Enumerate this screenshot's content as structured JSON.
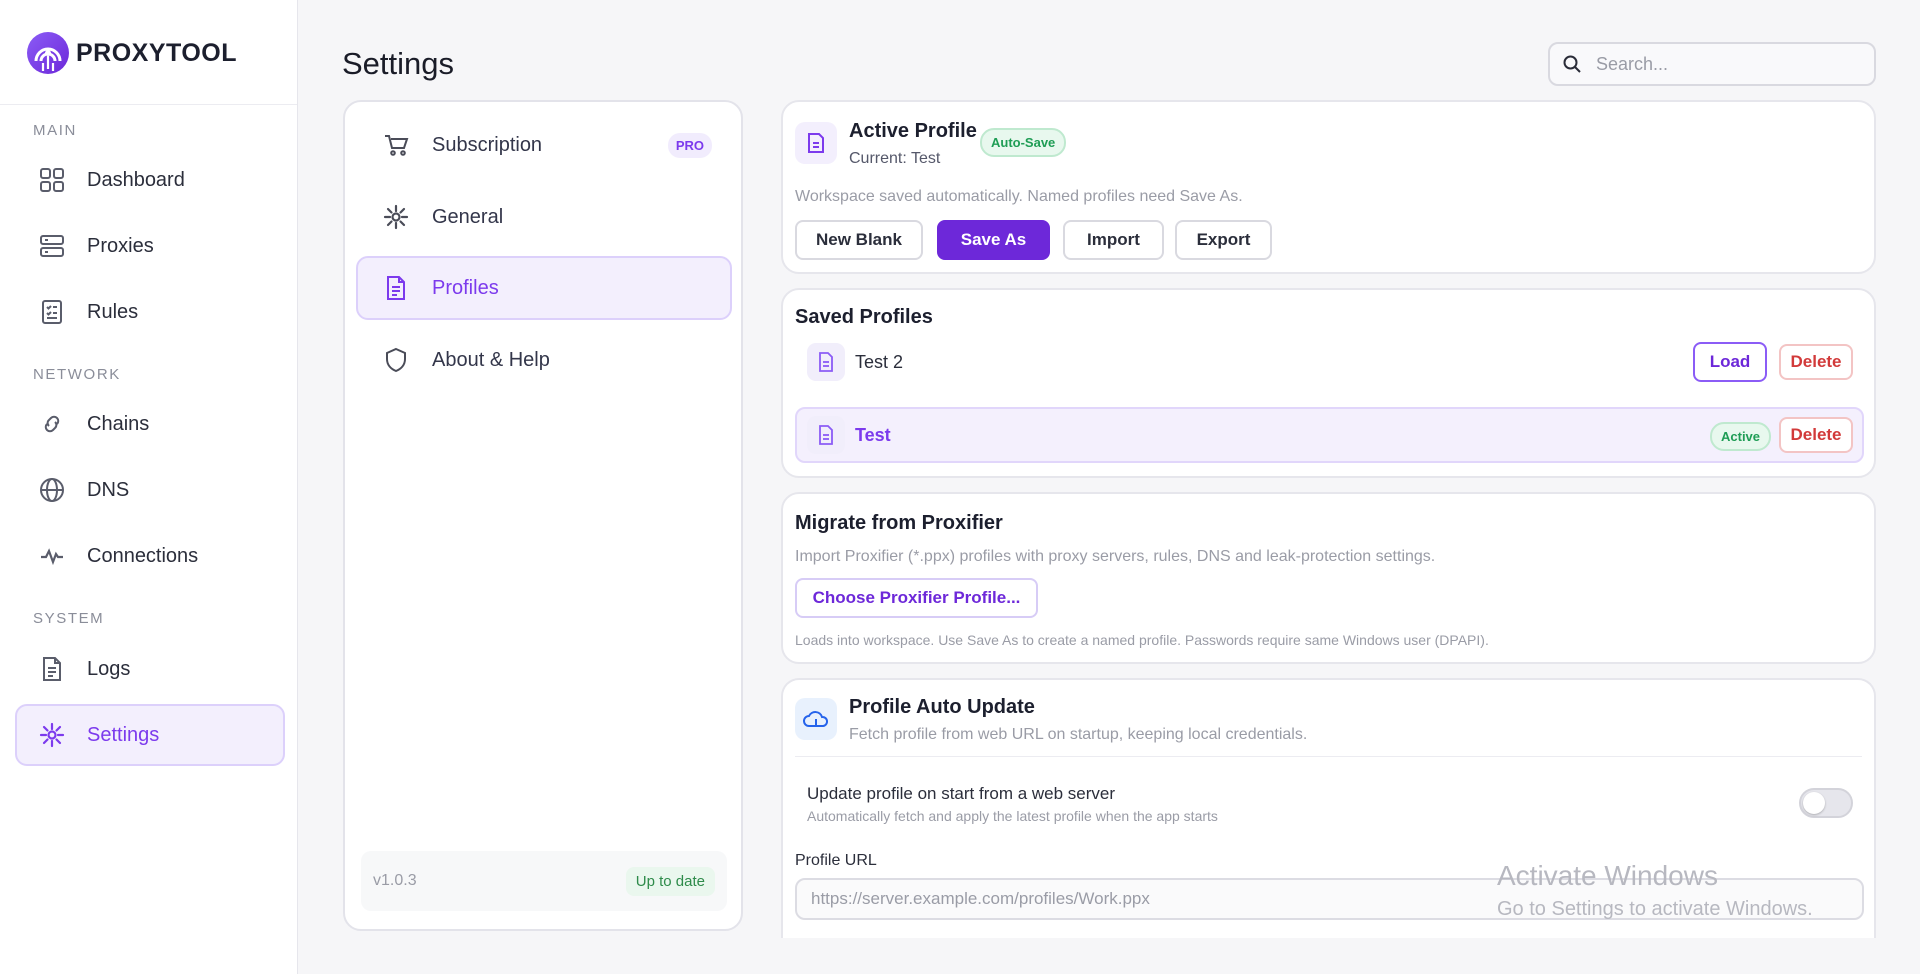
{
  "app": {
    "name": "PROXYTOOL",
    "logo_icon": "proxytool-logo"
  },
  "sidebar": {
    "sections": [
      {
        "label": "MAIN",
        "items": [
          {
            "label": "Dashboard",
            "icon": "grid-icon"
          },
          {
            "label": "Proxies",
            "icon": "server-icon"
          },
          {
            "label": "Rules",
            "icon": "checklist-icon"
          }
        ]
      },
      {
        "label": "NETWORK",
        "items": [
          {
            "label": "Chains",
            "icon": "link-icon"
          },
          {
            "label": "DNS",
            "icon": "globe-icon"
          },
          {
            "label": "Connections",
            "icon": "activity-icon"
          }
        ]
      },
      {
        "label": "SYSTEM",
        "items": [
          {
            "label": "Logs",
            "icon": "file-text-icon"
          },
          {
            "label": "Settings",
            "icon": "settings-icon",
            "active": true
          }
        ]
      }
    ]
  },
  "header": {
    "title": "Settings",
    "search_placeholder": "Search..."
  },
  "settings_nav": {
    "items": [
      {
        "label": "Subscription",
        "icon": "cart-icon",
        "badge": "PRO"
      },
      {
        "label": "General",
        "icon": "gear-icon"
      },
      {
        "label": "Profiles",
        "icon": "document-icon",
        "active": true
      },
      {
        "label": "About & Help",
        "icon": "shield-icon"
      }
    ],
    "version": "v1.0.3",
    "status": "Up to date"
  },
  "active_profile": {
    "title": "Active Profile",
    "current": "Current: Test",
    "badge": "Auto-Save",
    "description": "Workspace saved automatically. Named profiles need Save As.",
    "buttons": {
      "new_blank": "New Blank",
      "save_as": "Save As",
      "import": "Import",
      "export": "Export"
    }
  },
  "saved_profiles": {
    "title": "Saved Profiles",
    "rows": [
      {
        "name": "Test 2",
        "load": "Load",
        "delete": "Delete"
      },
      {
        "name": "Test",
        "status": "Active",
        "delete": "Delete",
        "active": true
      }
    ]
  },
  "migrate": {
    "title": "Migrate from Proxifier",
    "description": "Import Proxifier (*.ppx) profiles with proxy servers, rules, DNS and leak-protection settings.",
    "button": "Choose Proxifier Profile...",
    "note": "Loads into workspace. Use Save As to create a named profile. Passwords require same Windows user (DPAPI)."
  },
  "auto_update": {
    "title": "Profile Auto Update",
    "subtitle": "Fetch profile from web URL on startup, keeping local credentials.",
    "toggle_label": "Update profile on start from a web server",
    "toggle_desc": "Automatically fetch and apply the latest profile when the app starts",
    "toggle_on": false,
    "url_label": "Profile URL",
    "url_placeholder": "https://server.example.com/profiles/Work.ppx"
  },
  "watermark": {
    "title": "Activate Windows",
    "subtitle": "Go to Settings to activate Windows."
  },
  "colors": {
    "accent": "#7c3aed",
    "primary_button": "#6d28d9",
    "success": "#1f9d55",
    "danger": "#d23a3a"
  }
}
